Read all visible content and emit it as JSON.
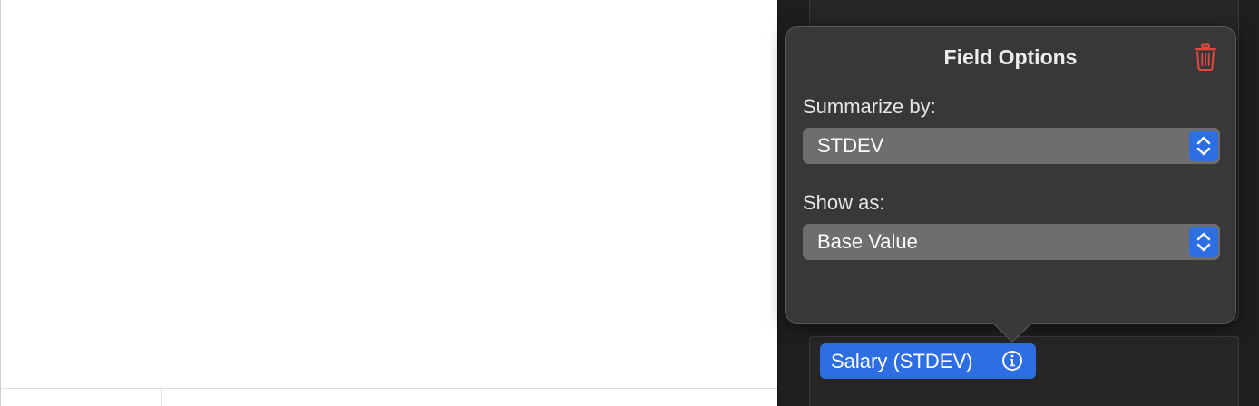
{
  "popover": {
    "title": "Field Options",
    "summarize_label": "Summarize by:",
    "summarize_value": "STDEV",
    "show_as_label": "Show as:",
    "show_as_value": "Base Value"
  },
  "field_chip": {
    "label": "Salary (STDEV)"
  },
  "icons": {
    "delete": "trash-icon",
    "info": "info-circle-icon",
    "popup": "chevron-up-down-icon"
  },
  "colors": {
    "accent": "#2d6fe3",
    "delete": "#e0483e",
    "popover_bg": "#383838",
    "select_bg": "#6e6e6e"
  }
}
